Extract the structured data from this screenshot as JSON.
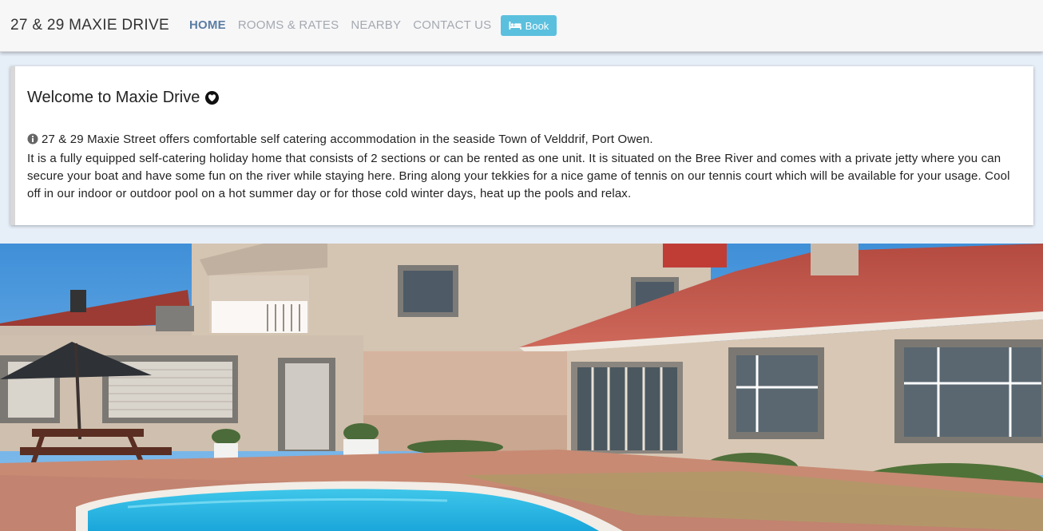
{
  "navbar": {
    "brand": "27 & 29 MAXIE DRIVE",
    "items": [
      {
        "label": "HOME",
        "active": true
      },
      {
        "label": "ROOMS & RATES",
        "active": false
      },
      {
        "label": "NEARBY",
        "active": false
      },
      {
        "label": "CONTACT US",
        "active": false
      }
    ],
    "book_label": "Book",
    "book_icon": "bed-icon",
    "colors": {
      "active": "#5b7da4",
      "inactive": "#a4a9b0",
      "book_bg": "#5bc0de"
    }
  },
  "welcome": {
    "title": "Welcome to Maxie Drive",
    "title_icon": "heart-icon",
    "info_icon": "info-circle-icon",
    "line1": "27 & 29 Maxie Street offers comfortable self catering accommodation in the seaside Town of Velddrif, Port Owen.",
    "paragraph": "It is a fully equipped self-catering holiday home that consists of 2 sections or can be rented as one unit. It is situated on the Bree River and comes with a private jetty where you can secure your boat and have some fun on the river while staying here. Bring along your tekkies for a nice game of tennis on our tennis court which will be available for your usage. Cool off in our indoor or outdoor pool on a hot summer day or for those cold winter days, heat up the pools and relax."
  },
  "hero": {
    "content": "house-exterior-with-pool-photo"
  }
}
